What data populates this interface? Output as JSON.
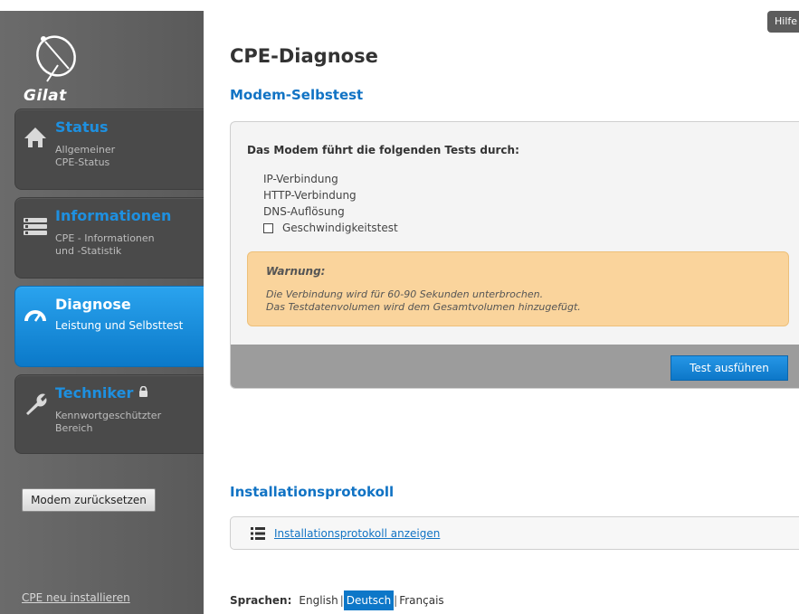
{
  "help": {
    "label": "Hilfe"
  },
  "brand": {
    "name": "Gilat"
  },
  "sidebar": {
    "items": [
      {
        "title": "Status",
        "subtitle": "Allgemeiner\nCPE-Status",
        "icon": "home-icon",
        "active": false
      },
      {
        "title": "Informationen",
        "subtitle": "CPE - Informationen\nund -Statistik",
        "icon": "list-icon",
        "active": false
      },
      {
        "title": "Diagnose",
        "subtitle": "Leistung und Selbsttest",
        "icon": "gauge-icon",
        "active": true
      },
      {
        "title": "Techniker",
        "subtitle": "Kennwortgeschützter\nBereich",
        "icon": "wrench-icon",
        "active": false,
        "locked": true
      }
    ],
    "reset_label": "Modem zurücksetzen",
    "reinstall_label": "CPE neu installieren"
  },
  "main": {
    "page_title": "CPE-Diagnose",
    "selftest": {
      "title": "Modem-Selbstest",
      "intro": "Das Modem führt die folgenden Tests durch:",
      "tests": [
        "IP-Verbindung",
        "HTTP-Verbindung",
        "DNS-Auflösung"
      ],
      "speedtest_label": "Geschwindigkeitstest",
      "speedtest_checked": false,
      "warning_title": "Warnung:",
      "warning_line1": "Die Verbindung wird für 60-90 Sekunden unterbrochen.",
      "warning_line2": "Das Testdatenvolumen wird dem Gesamtvolumen hinzugefügt.",
      "run_label": "Test ausführen"
    },
    "install_log": {
      "title": "Installationsprotokoll",
      "link_label": "Installationsprotokoll anzeigen"
    },
    "languages": {
      "label": "Sprachen:",
      "options": [
        "English",
        "Deutsch",
        "Français"
      ],
      "selected": "Deutsch"
    }
  },
  "colors": {
    "accent": "#1173c4",
    "active_nav": "#0d77c8",
    "warning_bg": "#fad49c",
    "sidebar_bg": "#5e5e5e"
  }
}
